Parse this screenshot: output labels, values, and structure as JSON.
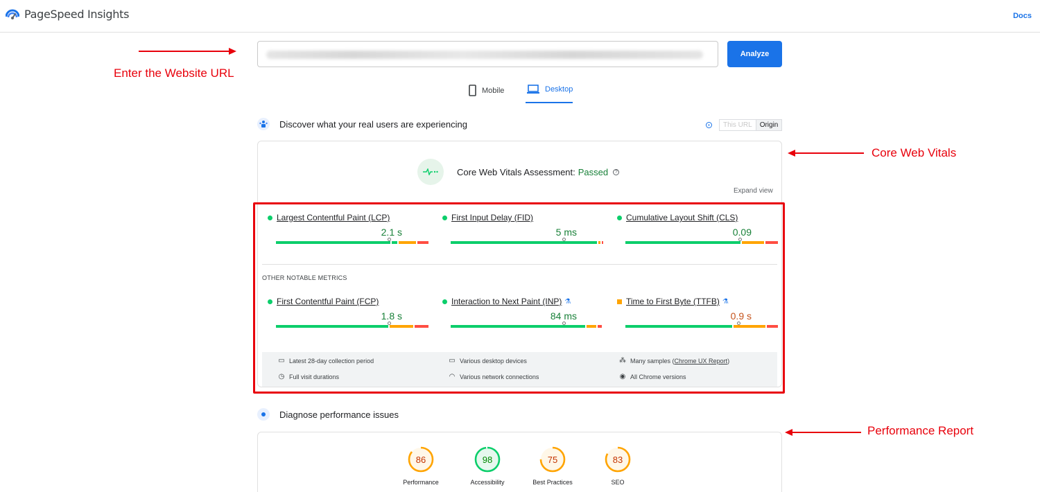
{
  "header": {
    "app_title": "PageSpeed Insights",
    "docs_link": "Docs"
  },
  "search": {
    "analyze_label": "Analyze"
  },
  "device_tabs": {
    "mobile": "Mobile",
    "desktop": "Desktop",
    "selected": "Desktop"
  },
  "field_section": {
    "heading": "Discover what your real users are experiencing",
    "toggle": {
      "this_url": "This URL",
      "origin": "Origin",
      "selected": "Origin"
    }
  },
  "assessment": {
    "label": "Core Web Vitals Assessment:",
    "status": "Passed",
    "expand_label": "Expand view"
  },
  "core_metrics": [
    {
      "name": "Largest Contentful Paint (LCP)",
      "value": "2.1 s",
      "status": "good"
    },
    {
      "name": "First Input Delay (FID)",
      "value": "5 ms",
      "status": "good"
    },
    {
      "name": "Cumulative Layout Shift (CLS)",
      "value": "0.09",
      "status": "good"
    }
  ],
  "other_label": "OTHER NOTABLE METRICS",
  "other_metrics": [
    {
      "name": "First Contentful Paint (FCP)",
      "value": "1.8 s",
      "status": "good"
    },
    {
      "name": "Interaction to Next Paint (INP)",
      "value": "84 ms",
      "status": "good",
      "experimental": true
    },
    {
      "name": "Time to First Byte (TTFB)",
      "value": "0.9 s",
      "status": "needs-improvement",
      "experimental": true
    }
  ],
  "footer_info": {
    "period": "Latest 28-day collection period",
    "devices": "Various desktop devices",
    "samples_prefix": "Many samples (",
    "samples_link": "Chrome UX Report",
    "samples_suffix": ")",
    "durations": "Full visit durations",
    "network": "Various network connections",
    "versions": "All Chrome versions"
  },
  "diagnose": {
    "heading": "Diagnose performance issues"
  },
  "scores": [
    {
      "name": "Performance",
      "value": "86",
      "color": "#ffa400"
    },
    {
      "name": "Accessibility",
      "value": "98",
      "color": "#0cce6b"
    },
    {
      "name": "Best Practices",
      "value": "75",
      "color": "#ffa400"
    },
    {
      "name": "SEO",
      "value": "83",
      "color": "#ffa400"
    }
  ],
  "annotations": {
    "enter_url": "Enter the Website URL",
    "core_web_vitals": "Core Web Vitals",
    "performance_report": "Performance Report"
  },
  "colors": {
    "accent": "#1a73e8",
    "good": "#0cce6b",
    "average": "#ffa400",
    "poor": "#ff4e42",
    "annotation": "#e8000b"
  }
}
